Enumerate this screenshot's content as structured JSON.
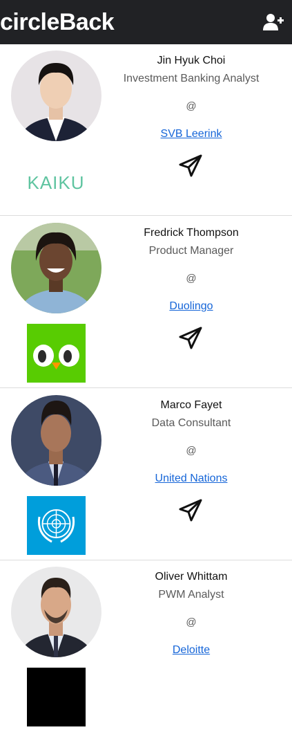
{
  "app": {
    "title": "circleBack",
    "add_user_icon": "user-plus-icon"
  },
  "contacts": [
    {
      "name": "Jin Hyuk Choi",
      "title": "Investment Banking Analyst",
      "at": "@",
      "company": "SVB Leerink",
      "logo_text": "KAIKU",
      "logo_color": "#5fc4a0"
    },
    {
      "name": "Fredrick Thompson",
      "title": "Product Manager",
      "at": "@",
      "company": "Duolingo",
      "logo_color": "#58cc02"
    },
    {
      "name": "Marco Fayet",
      "title": "Data Consultant",
      "at": "@",
      "company": "United Nations",
      "logo_color": "#009edb"
    },
    {
      "name": "Oliver Whittam",
      "title": "PWM Analyst",
      "at": "@",
      "company": "Deloitte"
    }
  ],
  "colors": {
    "navbar": "#212225",
    "link": "#1565d8"
  }
}
